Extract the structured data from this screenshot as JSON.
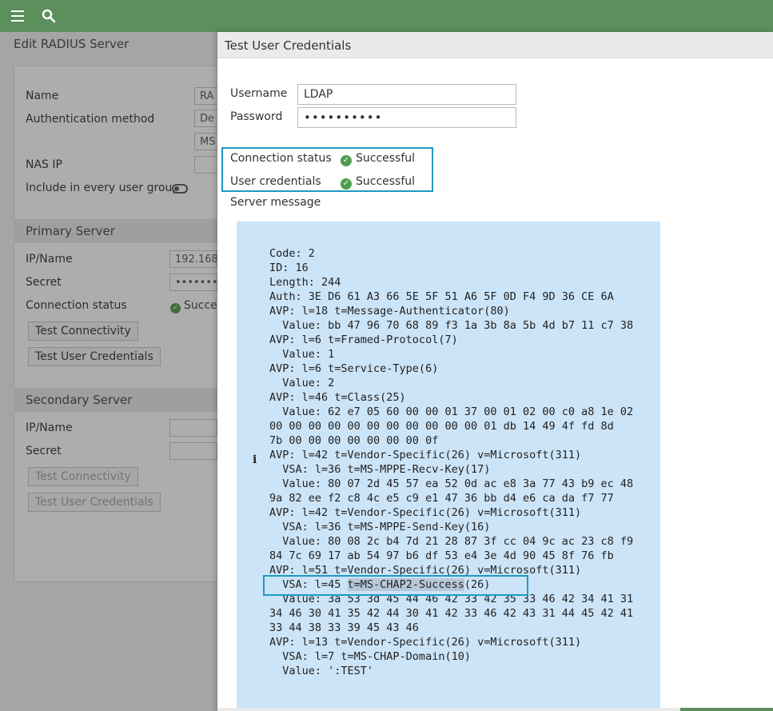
{
  "topbar": {
    "menu_icon": "hamburger-menu-icon",
    "search_icon": "search-icon",
    "color": "#5b8f5b"
  },
  "background": {
    "page_title": "Edit RADIUS Server",
    "name_label": "Name",
    "name_value": "RA",
    "auth_method_label": "Authentication method",
    "auth_method_value": "De",
    "auth_method_sub_value": "MS",
    "nas_ip_label": "NAS IP",
    "include_group_label": "Include in every user group",
    "primary_section": "Primary Server",
    "ip_name_label": "IP/Name",
    "primary_ip_value": "192.168",
    "secret_label": "Secret",
    "secret_value": "•••••••",
    "conn_status_label": "Connection status",
    "conn_status_value": "Succe",
    "test_connectivity": "Test Connectivity",
    "test_user_credentials": "Test User Credentials",
    "secondary_section": "Secondary Server",
    "sec_ip_name_label": "IP/Name",
    "sec_secret_label": "Secret",
    "sec_test_connectivity": "Test Connectivity",
    "sec_test_user_credentials": "Test User Credentials"
  },
  "panel": {
    "title": "Test User Credentials",
    "username_label": "Username",
    "username_value": "LDAP",
    "password_label": "Password",
    "password_value": "••••••••••",
    "connection_status_label": "Connection status",
    "connection_status_value": "Successful",
    "user_credentials_label": "User credentials",
    "user_credentials_value": "Successful",
    "server_message_label": "Server message",
    "info_icon": "info-icon",
    "highlight_color": "#1e9ac2",
    "message_lines": [
      "Code: 2",
      "ID: 16",
      "Length: 244",
      "Auth: 3E D6 61 A3 66 5E 5F 51 A6 5F 0D F4 9D 36 CE 6A",
      "AVP: l=18 t=Message-Authenticator(80)",
      "  Value: bb 47 96 70 68 89 f3 1a 3b 8a 5b 4d b7 11 c7 38",
      "AVP: l=6 t=Framed-Protocol(7)",
      "  Value: 1",
      "AVP: l=6 t=Service-Type(6)",
      "  Value: 2",
      "AVP: l=46 t=Class(25)",
      "  Value: 62 e7 05 60 00 00 01 37 00 01 02 00 c0 a8 1e 02",
      "00 00 00 00 00 00 00 00 00 00 00 01 db 14 49 4f fd 8d",
      "7b 00 00 00 00 00 00 00 0f",
      "AVP: l=42 t=Vendor-Specific(26) v=Microsoft(311)",
      "  VSA: l=36 t=MS-MPPE-Recv-Key(17)",
      "  Value: 80 07 2d 45 57 ea 52 0d ac e8 3a 77 43 b9 ec 48",
      "9a 82 ee f2 c8 4c e5 c9 e1 47 36 bb d4 e6 ca da f7 77",
      "AVP: l=42 t=Vendor-Specific(26) v=Microsoft(311)",
      "  VSA: l=36 t=MS-MPPE-Send-Key(16)",
      "  Value: 80 08 2c b4 7d 21 28 87 3f cc 04 9c ac 23 c8 f9",
      "84 7c 69 17 ab 54 97 b6 df 53 e4 3e 4d 90 45 8f 76 fb",
      "AVP: l=51 t=Vendor-Specific(26) v=Microsoft(311)"
    ],
    "vsa_prefix": "  VSA: l=45 ",
    "vsa_highlight": "t=MS-CHAP2-Success",
    "vsa_suffix": "(26)",
    "message_lines_after": [
      "  Value: 3a 53 3d 45 44 46 42 33 42 35 33 46 42 34 41 31",
      "34 46 30 41 35 42 44 30 41 42 33 46 42 43 31 44 45 42 41",
      "33 44 38 33 39 45 43 46",
      "AVP: l=13 t=Vendor-Specific(26) v=Microsoft(311)",
      "  VSA: l=7 t=MS-CHAP-Domain(10)",
      "  Value: ':TEST'"
    ]
  }
}
